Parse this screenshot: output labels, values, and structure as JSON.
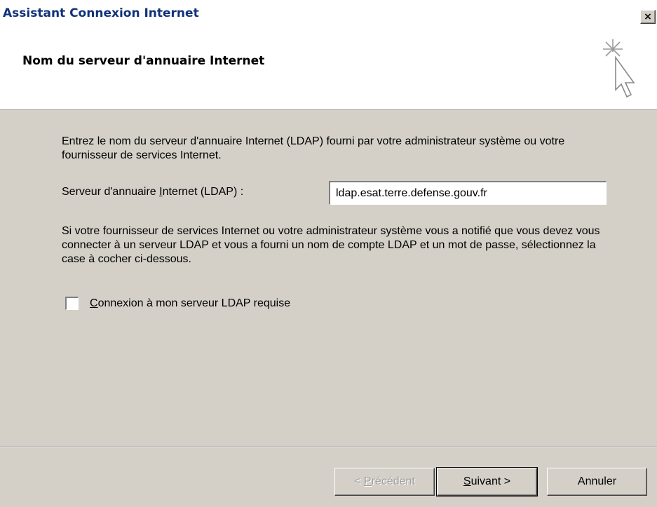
{
  "window": {
    "title": "Assistant Connexion Internet",
    "close_label": "×"
  },
  "header": {
    "title": "Nom du serveur d'annuaire Internet"
  },
  "body": {
    "intro": "Entrez le nom du serveur d'annuaire Internet (LDAP) fourni par votre administrateur système ou votre fournisseur de services Internet.",
    "ldap_label_pre": "Serveur d'annuaire ",
    "ldap_label_key": "I",
    "ldap_label_post": "nternet (LDAP) :",
    "ldap_value": "ldap.esat.terre.defense.gouv.fr",
    "info": "Si votre fournisseur de services Internet ou votre administrateur système vous a notifié que vous devez vous connecter à un serveur LDAP et vous a fourni un nom de compte LDAP et un mot de passe, sélectionnez la case à cocher ci-dessous.",
    "checkbox_key": "C",
    "checkbox_rest": "onnexion à mon serveur LDAP requise",
    "checkbox_checked": false
  },
  "buttons": {
    "prev_pre": "< ",
    "prev_key": "P",
    "prev_rest": "récédent",
    "next_key": "S",
    "next_rest": "uivant >",
    "cancel": "Annuler"
  }
}
